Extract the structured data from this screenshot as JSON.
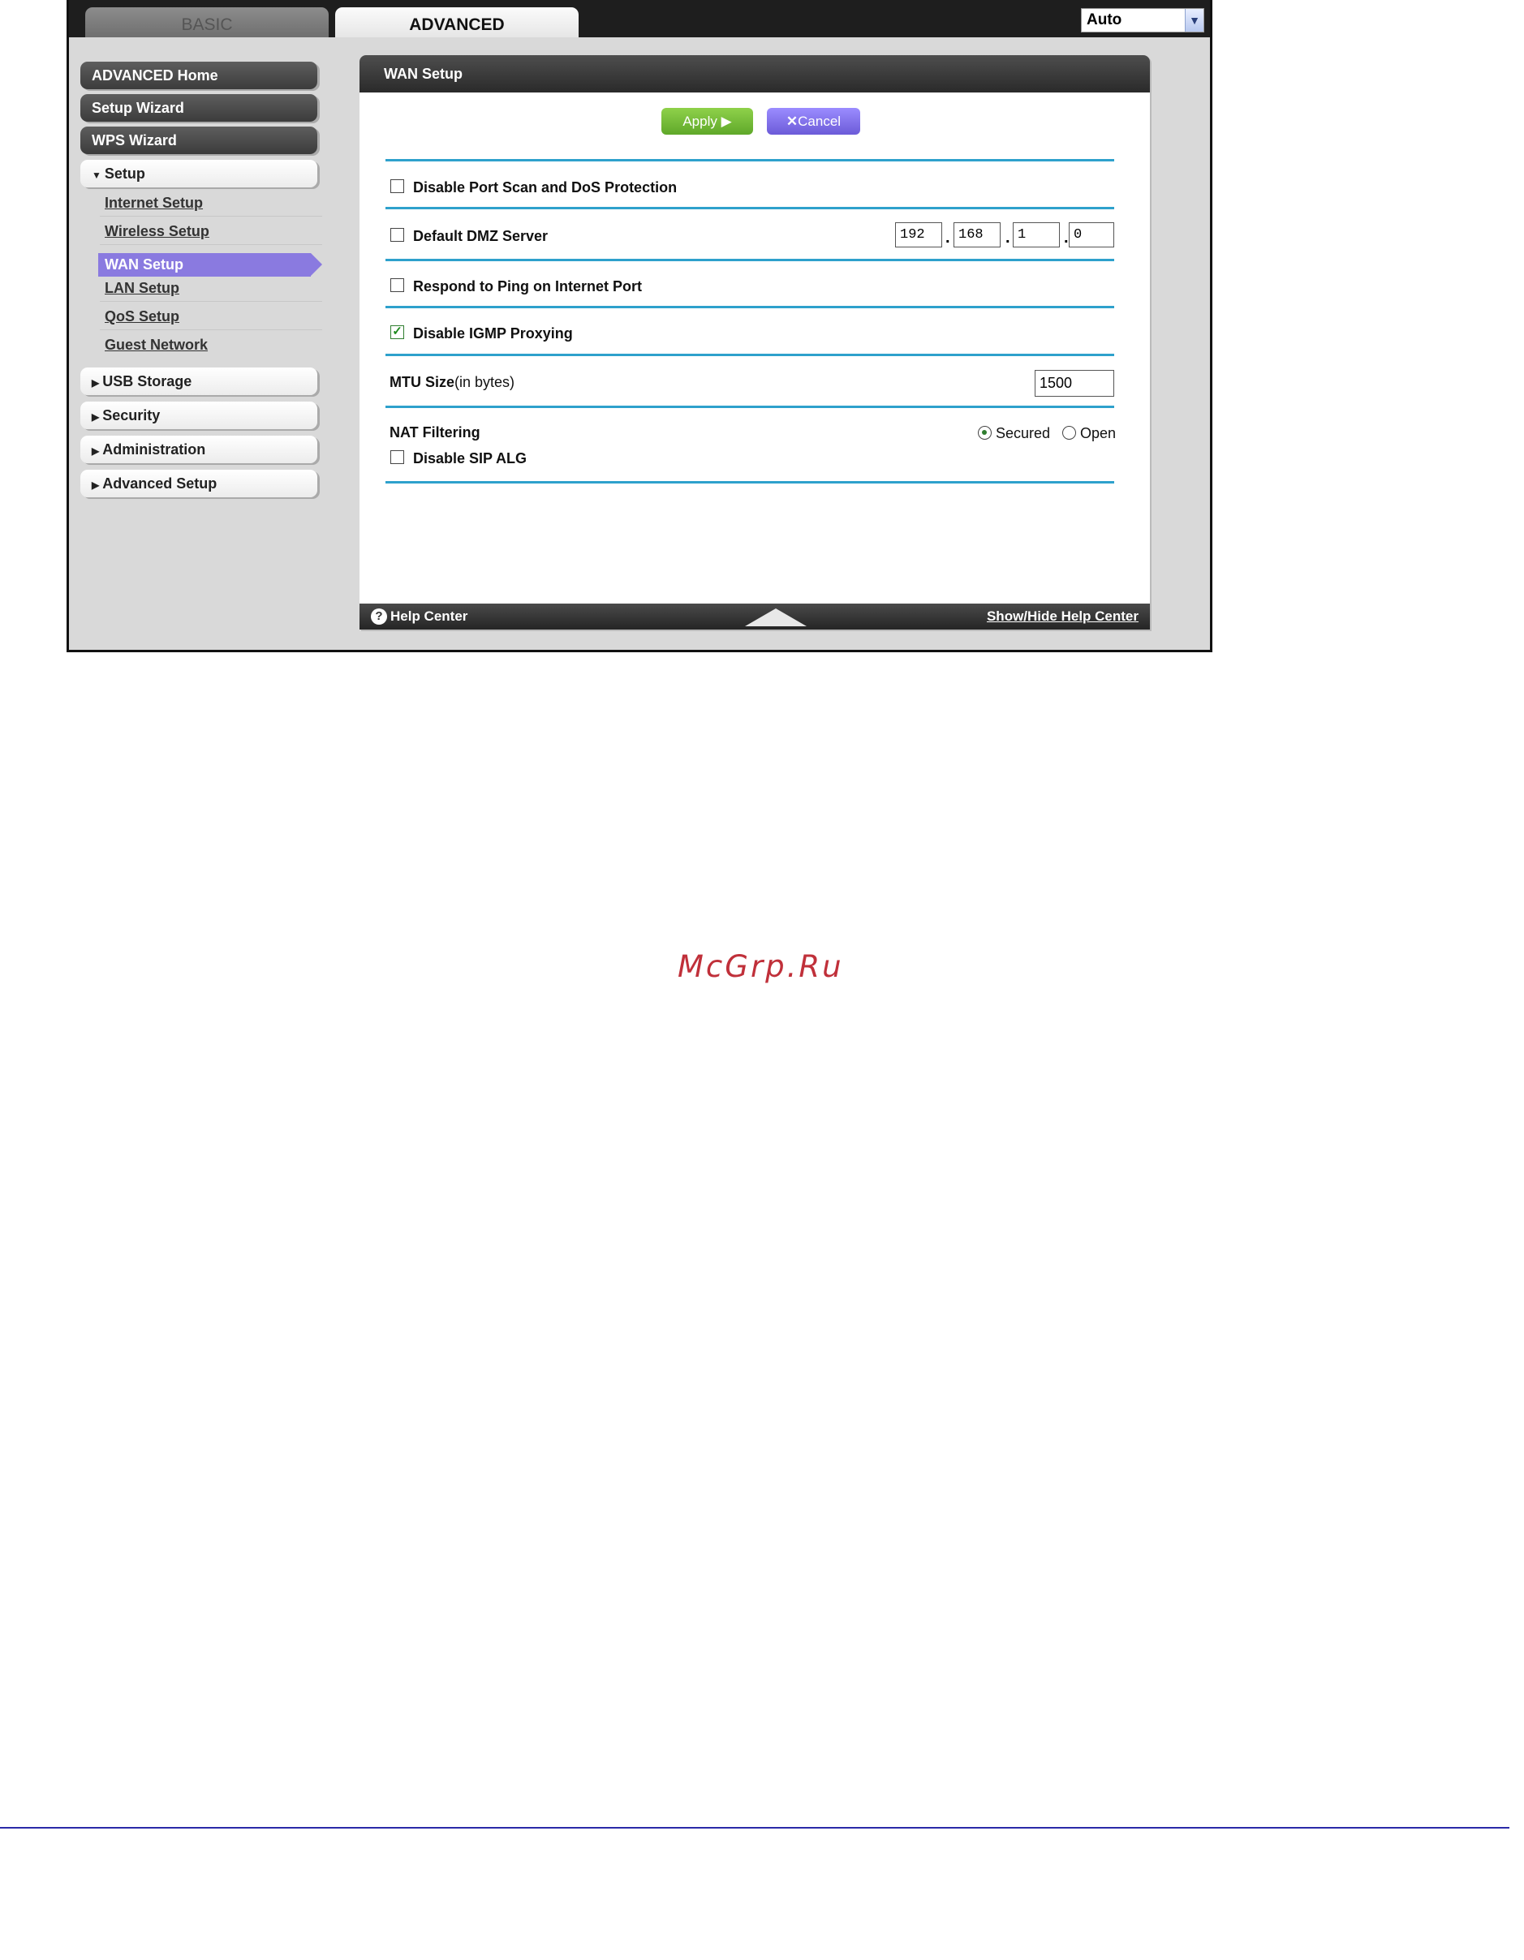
{
  "tabs": {
    "basic": "BASIC",
    "advanced": "ADVANCED"
  },
  "language_select": {
    "value": "Auto"
  },
  "sidebar": {
    "main_items": [
      {
        "label": "ADVANCED Home"
      },
      {
        "label": "Setup Wizard"
      },
      {
        "label": "WPS Wizard"
      }
    ],
    "setup": {
      "label": "Setup",
      "subitems": [
        {
          "label": "Internet Setup"
        },
        {
          "label": "Wireless Setup"
        },
        {
          "label": "WAN Setup",
          "active": true
        },
        {
          "label": "LAN Setup"
        },
        {
          "label": "QoS Setup"
        },
        {
          "label": "Guest Network"
        }
      ]
    },
    "sections": [
      {
        "label": "USB Storage"
      },
      {
        "label": "Security"
      },
      {
        "label": "Administration"
      },
      {
        "label": "Advanced Setup"
      }
    ]
  },
  "panel": {
    "title": "WAN Setup",
    "apply_label": "Apply ▶",
    "cancel_label": "Cancel",
    "disable_port_scan": {
      "label": "Disable Port Scan and DoS Protection",
      "checked": false
    },
    "default_dmz": {
      "label": "Default DMZ Server",
      "checked": false,
      "ip": [
        "192",
        "168",
        "1",
        "0"
      ]
    },
    "respond_ping": {
      "label": "Respond to Ping on Internet Port",
      "checked": false
    },
    "disable_igmp": {
      "label": "Disable IGMP Proxying",
      "checked": true
    },
    "mtu": {
      "label_bold": "MTU Size",
      "label_suffix": "(in bytes)",
      "value": "1500"
    },
    "nat_filtering": {
      "label": "NAT Filtering",
      "secured_label": "Secured",
      "open_label": "Open",
      "selected": "Secured"
    },
    "disable_sip_alg": {
      "label": "Disable SIP ALG",
      "checked": false
    },
    "footer": {
      "help_label": "Help Center",
      "show_hide_label": "Show/Hide Help Center"
    }
  },
  "watermark": "McGrp.Ru",
  "colors": {
    "accent_blue": "#2ea1cc",
    "active_purple": "#8a7ae0",
    "apply_green": "#6fb832",
    "cancel_purple": "#7a6ae6"
  }
}
